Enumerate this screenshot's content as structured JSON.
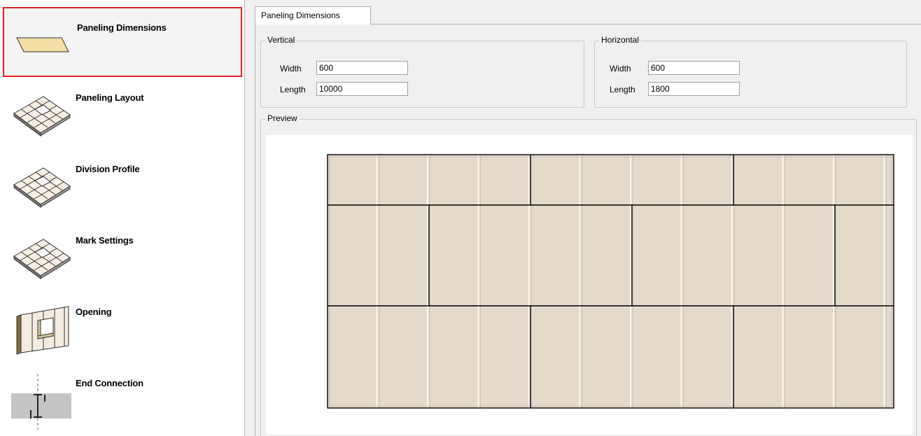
{
  "nav": {
    "items": [
      {
        "label": "Paneling Dimensions",
        "icon": "panel-sheet-icon"
      },
      {
        "label": "Paneling Layout",
        "icon": "paneling-layout-icon"
      },
      {
        "label": "Division Profile",
        "icon": "division-profile-icon"
      },
      {
        "label": "Mark Settings",
        "icon": "mark-settings-icon"
      },
      {
        "label": "Opening",
        "icon": "opening-wall-icon"
      },
      {
        "label": "End Connection",
        "icon": "end-connection-icon"
      }
    ],
    "selected_index": 0,
    "selection_color": "#e02020"
  },
  "tab": {
    "label": "Paneling Dimensions"
  },
  "vertical": {
    "title": "Vertical",
    "width_label": "Width",
    "width_value": "600",
    "length_label": "Length",
    "length_value": "10000"
  },
  "horizontal": {
    "title": "Horizontal",
    "width_label": "Width",
    "width_value": "600",
    "length_label": "Length",
    "length_value": "1800"
  },
  "preview": {
    "title": "Preview",
    "panel_fill": "#e3dacb",
    "line_color": "#000000"
  }
}
